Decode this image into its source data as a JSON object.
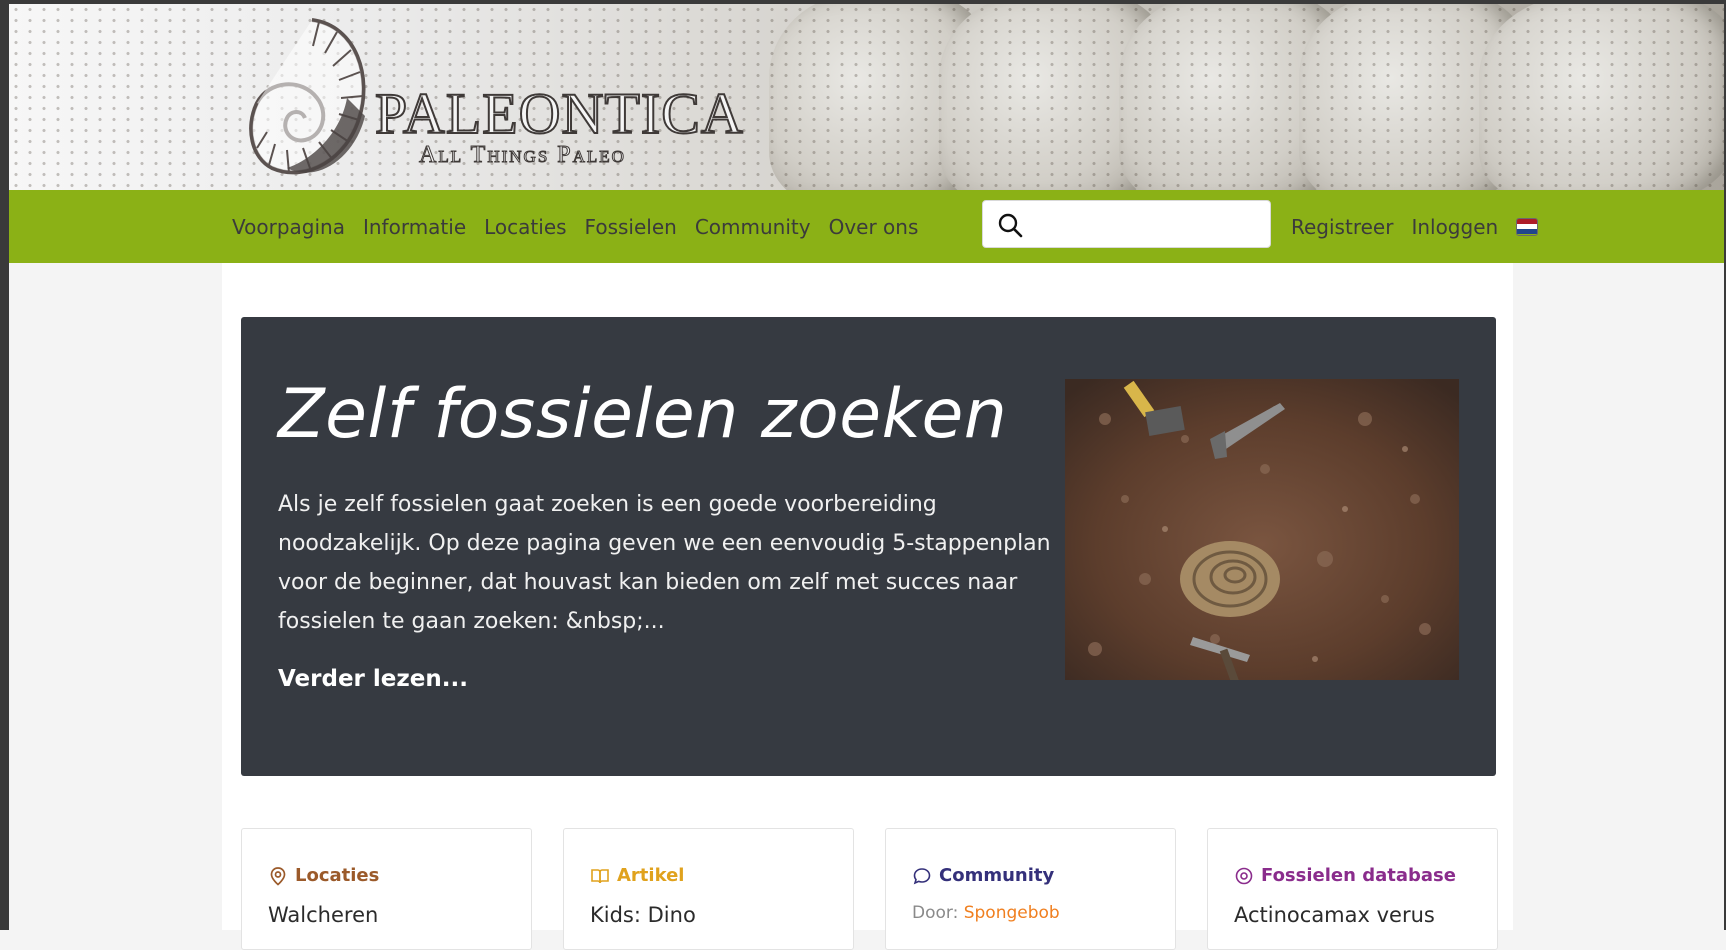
{
  "brand": {
    "name": "PALEONTICA",
    "tagline": "All Things Paleo"
  },
  "nav": {
    "links": [
      "Voorpagina",
      "Informatie",
      "Locaties",
      "Fossielen",
      "Community",
      "Over ons"
    ],
    "search_value": "",
    "register_label": "Registreer",
    "login_label": "Inloggen",
    "language_flag": "nl-flag"
  },
  "hero": {
    "title": "Zelf fossielen zoeken",
    "text": "Als je zelf fossielen gaat zoeken is een goede voorbereiding noodzakelijk. Op deze pagina geven we een eenvoudig 5-stappenplan voor de beginner, dat houvast kan bieden om zelf met succes naar fossielen te gaan zoeken: &nbsp;...",
    "more_label": "Verder lezen..."
  },
  "cards": [
    {
      "category": "Locaties",
      "icon": "map-pin-icon",
      "color": "#9b5a2a",
      "title": "Walcheren"
    },
    {
      "category": "Artikel",
      "icon": "book-icon",
      "color": "#e0a21d",
      "title": "Kids: Dino"
    },
    {
      "category": "Community",
      "icon": "chat-bubble-icon",
      "color": "#34307a",
      "meta_prefix": "Door: ",
      "author": "Spongebob"
    },
    {
      "category": "Fossielen database",
      "icon": "eye-icon",
      "color": "#8a2c8c",
      "title": "Actinocamax verus"
    }
  ],
  "colors": {
    "nav_green": "#8bb116",
    "hero_bg": "#363a41",
    "author_orange": "#f07f1f"
  }
}
